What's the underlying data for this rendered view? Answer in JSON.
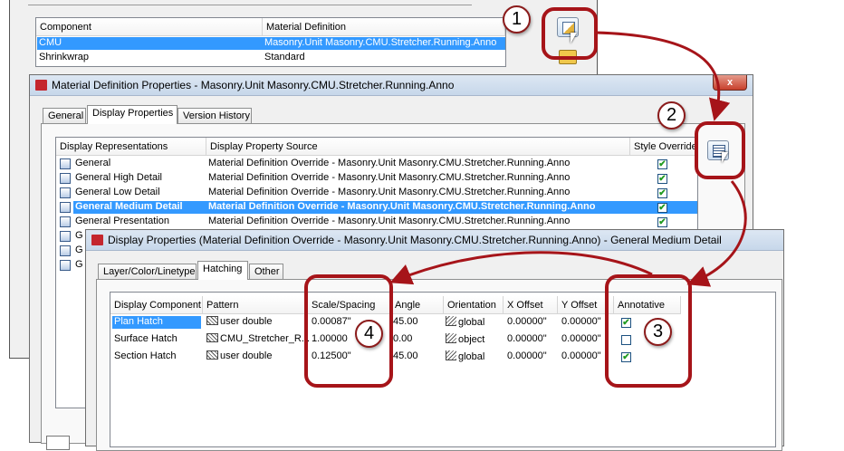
{
  "style_manager": {
    "headers": [
      "Component",
      "Material Definition"
    ],
    "rows": [
      {
        "component": "CMU",
        "material": "Masonry.Unit Masonry.CMU.Stretcher.Running.Anno",
        "selected": true
      },
      {
        "component": "Shrinkwrap",
        "material": "Standard",
        "selected": false
      }
    ]
  },
  "material_dialog": {
    "title": "Material Definition Properties - Masonry.Unit Masonry.CMU.Stretcher.Running.Anno",
    "close_label": "x",
    "tabs": [
      "General",
      "Display Properties",
      "Version History"
    ],
    "headers": [
      "Display Representations",
      "Display Property Source",
      "Style Override"
    ],
    "rows": [
      {
        "rep": "General",
        "source": "Material Definition Override - Masonry.Unit Masonry.CMU.Stretcher.Running.Anno",
        "override": true,
        "selected": false
      },
      {
        "rep": "General High Detail",
        "source": "Material Definition Override - Masonry.Unit Masonry.CMU.Stretcher.Running.Anno",
        "override": true,
        "selected": false
      },
      {
        "rep": "General Low Detail",
        "source": "Material Definition Override - Masonry.Unit Masonry.CMU.Stretcher.Running.Anno",
        "override": true,
        "selected": false
      },
      {
        "rep": "General Medium Detail",
        "source": "Material Definition Override - Masonry.Unit Masonry.CMU.Stretcher.Running.Anno",
        "override": true,
        "selected": true
      },
      {
        "rep": "General Presentation",
        "source": "Material Definition Override - Masonry.Unit Masonry.CMU.Stretcher.Running.Anno",
        "override": true,
        "selected": false
      }
    ],
    "truncated_labels": [
      "G",
      "G",
      "G"
    ]
  },
  "display_dialog": {
    "title": "Display Properties (Material Definition Override - Masonry.Unit Masonry.CMU.Stretcher.Running.Anno) - General Medium Detail",
    "tabs": [
      "Layer/Color/Linetype",
      "Hatching",
      "Other"
    ],
    "headers": [
      "Display Component",
      "Pattern",
      "Scale/Spacing",
      "Angle",
      "Orientation",
      "X Offset",
      "Y Offset",
      "Annotative"
    ],
    "rows": [
      {
        "component": "Plan Hatch",
        "pattern": "user double",
        "scale": "0.00087\"",
        "angle": "45.00",
        "orientation": "global",
        "x_offset": "0.00000\"",
        "y_offset": "0.00000\"",
        "annotative": true,
        "selected": true
      },
      {
        "component": "Surface Hatch",
        "pattern": "CMU_Stretcher_R...",
        "scale": "1.00000",
        "angle": "0.00",
        "orientation": "object",
        "x_offset": "0.00000\"",
        "y_offset": "0.00000\"",
        "annotative": false,
        "selected": false
      },
      {
        "component": "Section Hatch",
        "pattern": "user double",
        "scale": "0.12500\"",
        "angle": "45.00",
        "orientation": "global",
        "x_offset": "0.00000\"",
        "y_offset": "0.00000\"",
        "annotative": true,
        "selected": false
      }
    ]
  },
  "callouts": [
    "1",
    "2",
    "3",
    "4"
  ],
  "colors": {
    "callout_red": "#a61419",
    "selection_blue": "#3399ff",
    "check_green": "#219b21"
  }
}
